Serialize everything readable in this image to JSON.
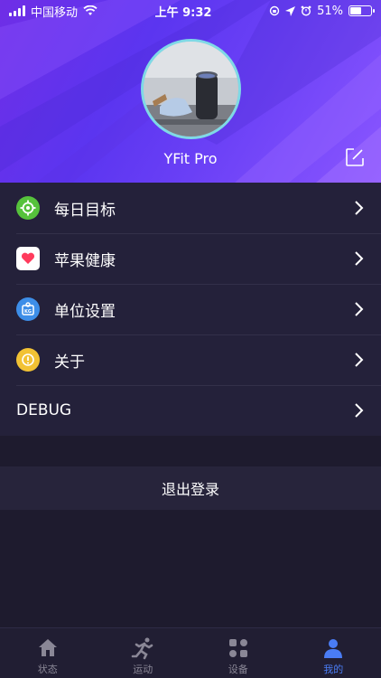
{
  "status_bar": {
    "carrier": "中国移动",
    "time": "上午 9:32",
    "battery": "51%"
  },
  "profile": {
    "username": "YFit Pro"
  },
  "menu": {
    "items": [
      {
        "label": "每日目标",
        "icon": "target-icon",
        "color": "#56c23c"
      },
      {
        "label": "苹果健康",
        "icon": "heart-icon",
        "color": "#ffffff"
      },
      {
        "label": "单位设置",
        "icon": "weight-icon",
        "color": "#3d8ee8"
      },
      {
        "label": "关于",
        "icon": "info-icon",
        "color": "#f2c234"
      },
      {
        "label": "DEBUG",
        "icon": "",
        "color": ""
      }
    ]
  },
  "logout": {
    "label": "退出登录"
  },
  "tabbar": {
    "tabs": [
      {
        "label": "状态",
        "icon": "home-icon"
      },
      {
        "label": "运动",
        "icon": "running-icon"
      },
      {
        "label": "设备",
        "icon": "devices-icon"
      },
      {
        "label": "我的",
        "icon": "person-icon",
        "active": true
      }
    ]
  },
  "colors": {
    "header_gradient_start": "#6f2ee6",
    "header_gradient_end": "#8a56ff",
    "background": "#1e1b2e",
    "menu_background": "#24213a",
    "active_tab": "#4a7cf4",
    "inactive_tab": "#8a8796"
  }
}
